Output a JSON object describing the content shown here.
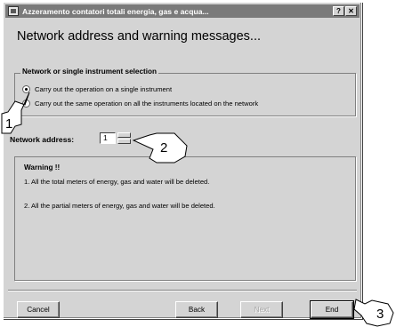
{
  "window": {
    "title": "Azzeramento contatori totali energia, gas e acqua...",
    "help_label": "?",
    "close_label": "✕"
  },
  "heading": "Network address and warning messages...",
  "selection_group": {
    "legend": "Network or single instrument selection",
    "options": [
      {
        "label": "Carry out the operation on a single instrument",
        "checked": true
      },
      {
        "label": "Carry out the same operation on all the instruments located on the network",
        "checked": false
      }
    ]
  },
  "network_address": {
    "label": "Network address:",
    "value": "1"
  },
  "warning_group": {
    "title": "Warning !!",
    "lines": [
      "1.  All the total meters of energy, gas and water will be deleted.",
      "2.  All the partial meters of energy, gas and water will be deleted."
    ]
  },
  "buttons": {
    "cancel": "Cancel",
    "back": "Back",
    "next": "Next",
    "end": "End"
  },
  "callouts": [
    "1",
    "2",
    "3"
  ]
}
